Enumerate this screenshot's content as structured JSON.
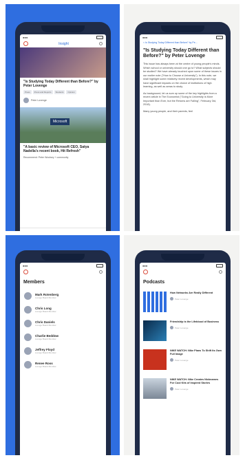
{
  "screen1": {
    "topbar_title": "Insight",
    "article1_title": "\"Is Studying Today Different than Before?\" by Peter Lovenge",
    "tags": [
      "Press",
      "Press and Reports",
      "Students",
      "Opinion"
    ],
    "author_name": "Peter Lovenge",
    "article2_badge": "Microsoft",
    "article2_title": "\"A basic review of Microsoft CEO, Satya Nadella's recent book, Hit Refresh\"",
    "article2_byline": "Recommend: Peter Woolsey + community"
  },
  "screen2": {
    "link_text": "< Is Studying Today Different than Before? by Pe...",
    "heading": "\"Is Studying Today Different than Before?\" by Peter Lovenge",
    "para1": "This issue has always been at the centre of young people's minds. Which school or university should one go to? What subjects should be studied? We have already touched upon some of these issues in our earlier note (\"How to Choose a University\"). In this note, we shall highlight some relatively recent developments, which may have significant impacts on the choice of institutions of high learning, as well as areas to study.",
    "para2": "As background, let us sum up some of the key highlights from a recent article in The Economist (\"Going to University is More Important than Ever, but the Returns are Falling\", February 3rd, 2018).",
    "para3": "Many young people, and their parents, feel"
  },
  "screen3": {
    "page_title": "Members",
    "members": [
      {
        "name": "Mark Rotenberg",
        "sub": "Lounge Board Member"
      },
      {
        "name": "Chris Long",
        "sub": "Lounge Board Member"
      },
      {
        "name": "Chris Daniels",
        "sub": "Lounge Board Member"
      },
      {
        "name": "Charlie Beddow",
        "sub": "Lounge Board Member"
      },
      {
        "name": "Jeffrey Floyd",
        "sub": "Lounge Board Member"
      },
      {
        "name": "Renee Ross",
        "sub": "Lounge Board Member"
      }
    ]
  },
  "screen4": {
    "page_title": "Podcasts",
    "podcasts": [
      {
        "title": "How Networks Are Really Different",
        "author": "Peter Lovenge"
      },
      {
        "title": "Friendship is the Lifeblood of Business",
        "author": "Peter Lovenge"
      },
      {
        "title": "NIKE WATCH: Nike Plans To Shift Its Own Full Image",
        "author": "Peter Lovenge"
      },
      {
        "title": "NIKE WATCH: Nike Creates Nicknames For Cool Kits of Inspired Stories",
        "author": "Peter Lovenge"
      }
    ]
  },
  "colors": {
    "accent": "#2f6ee0",
    "frame": "#1f2b47",
    "link": "#2a6bd8"
  }
}
